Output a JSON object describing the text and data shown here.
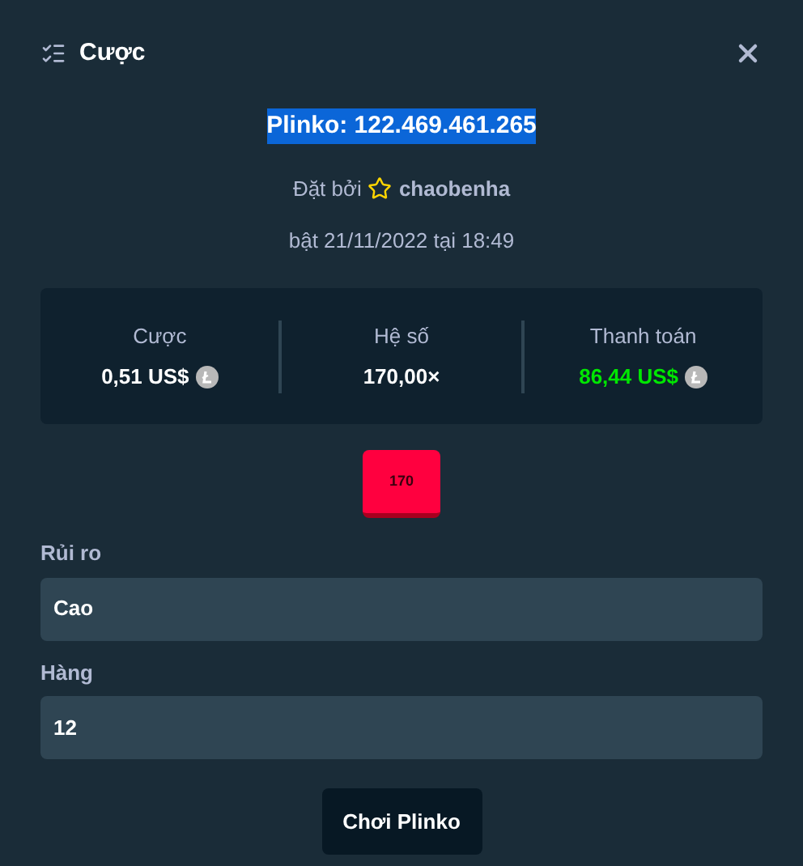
{
  "dialog": {
    "title": "Cược"
  },
  "bet": {
    "id": "Plinko: 122.469.461.265",
    "highlighted": true,
    "placed_by_label": "Đặt bởi",
    "user": "chaobenha",
    "date": "bật 21/11/2022 tại 18:49"
  },
  "stats": [
    {
      "label": "Cược",
      "value": "0,51 US$",
      "coin": true,
      "positive": false
    },
    {
      "label": "Hệ số",
      "value": "170,00×",
      "coin": false,
      "positive": false
    },
    {
      "label": "Thanh toán",
      "value": "86,44 US$",
      "coin": true,
      "positive": true
    }
  ],
  "result_tile": "170",
  "fields": [
    {
      "label": "Rủi ro",
      "value": "Cao"
    },
    {
      "label": "Hàng",
      "value": "12"
    }
  ],
  "button": "Chơi Plinko"
}
